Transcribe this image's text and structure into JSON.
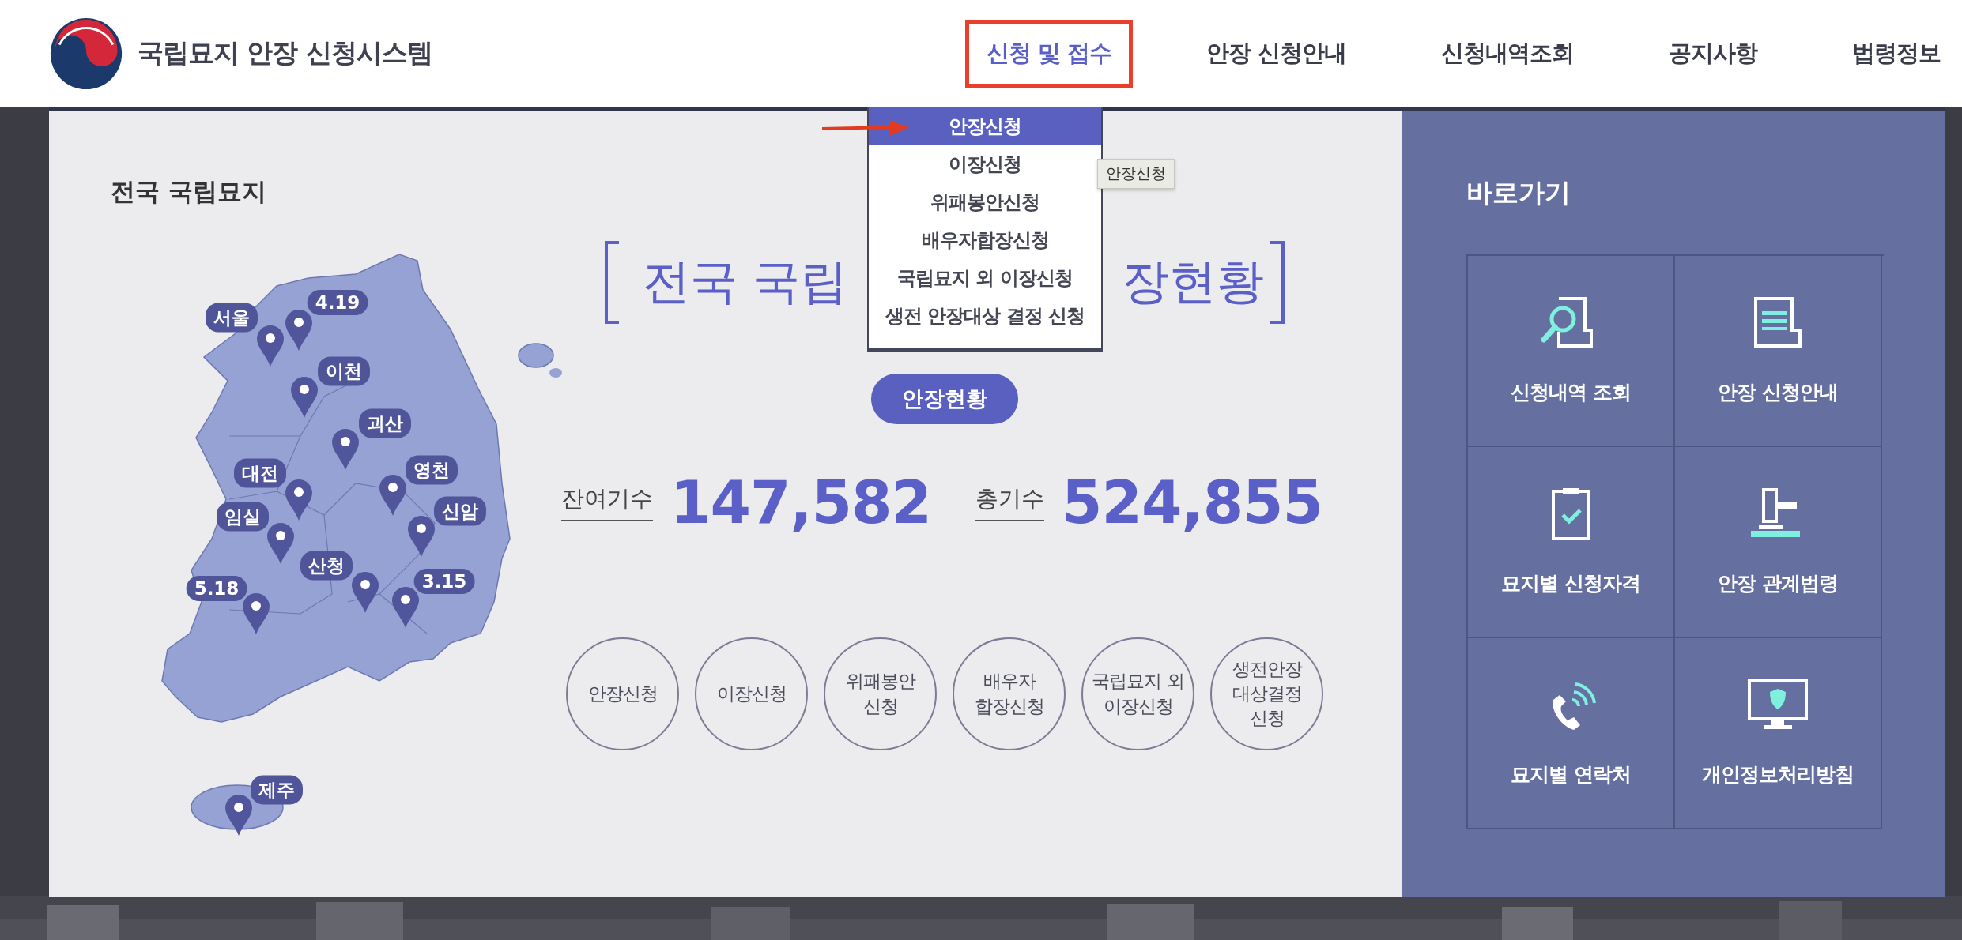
{
  "header": {
    "title": "국립묘지 안장 신청시스템"
  },
  "nav": [
    {
      "label": "신청 및 접수",
      "selected": true,
      "outlined": true
    },
    {
      "label": "안장 신청안내",
      "selected": false,
      "outlined": false
    },
    {
      "label": "신청내역조회",
      "selected": false,
      "outlined": false
    },
    {
      "label": "공지사항",
      "selected": false,
      "outlined": false
    },
    {
      "label": "법령정보",
      "selected": false,
      "outlined": false
    }
  ],
  "dropdown": {
    "items": [
      {
        "label": "안장신청",
        "selected": true
      },
      {
        "label": "이장신청",
        "selected": false
      },
      {
        "label": "위패봉안신청",
        "selected": false
      },
      {
        "label": "배우자합장신청",
        "selected": false
      },
      {
        "label": "국립묘지 외 이장신청",
        "selected": false
      },
      {
        "label": "생전 안장대상 결정 신청",
        "selected": false
      }
    ],
    "tooltip": "안장신청"
  },
  "map": {
    "title": "전국 국립묘지",
    "pins": [
      {
        "label": "서울"
      },
      {
        "label": "4.19"
      },
      {
        "label": "이천"
      },
      {
        "label": "괴산"
      },
      {
        "label": "대전"
      },
      {
        "label": "영천"
      },
      {
        "label": "임실"
      },
      {
        "label": "신암"
      },
      {
        "label": "산청"
      },
      {
        "label": "3.15"
      },
      {
        "label": "5.18"
      },
      {
        "label": "제주"
      }
    ]
  },
  "status": {
    "title_start": "전국 국립",
    "title_end": "장현황",
    "button": "안장현황",
    "stats": [
      {
        "label": "잔여기수",
        "value": "147,582"
      },
      {
        "label": "총기수",
        "value": "524,855"
      }
    ],
    "shortcuts": [
      "안장신청",
      "이장신청",
      "위패봉안\n신청",
      "배우자\n합장신청",
      "국립묘지 외\n이장신청",
      "생전안장\n대상결정\n신청"
    ]
  },
  "quick_links": {
    "title": "바로가기",
    "items": [
      {
        "label": "신청내역 조회",
        "kind": "search-document"
      },
      {
        "label": "안장 신청안내",
        "kind": "document"
      },
      {
        "label": "묘지별 신청자격",
        "kind": "clipboard-check"
      },
      {
        "label": "안장 관계법령",
        "kind": "gavel"
      },
      {
        "label": "묘지별 연락처",
        "kind": "phone-signal"
      },
      {
        "label": "개인정보처리방침",
        "kind": "monitor-shield"
      }
    ]
  }
}
